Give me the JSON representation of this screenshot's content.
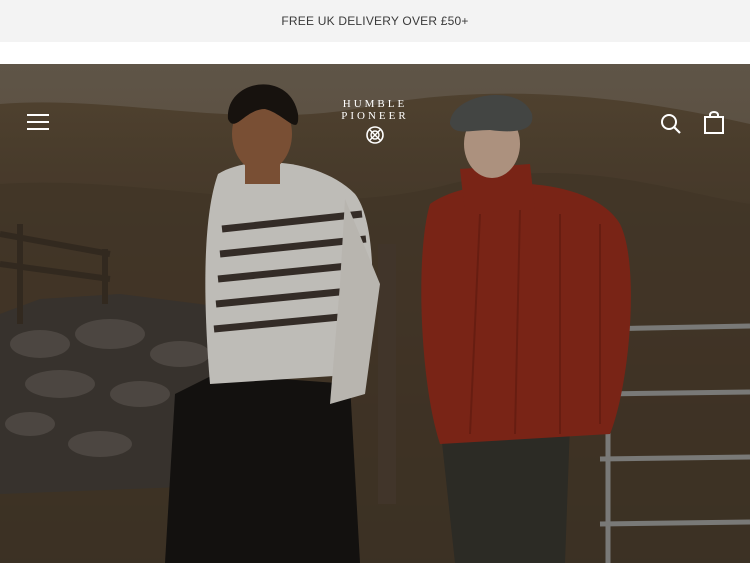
{
  "announcement": {
    "text": "FREE UK DELIVERY OVER £50+"
  },
  "logo": {
    "line1": "HUMBLE",
    "line2": "PIONEER"
  },
  "icons": {
    "menu": "hamburger-menu-icon",
    "search": "search-icon",
    "cart": "shopping-bag-icon",
    "logo_mark": "compass-logo-icon"
  },
  "colors": {
    "announcement_bg": "#f3f3f3",
    "header_icons": "#ffffff"
  }
}
